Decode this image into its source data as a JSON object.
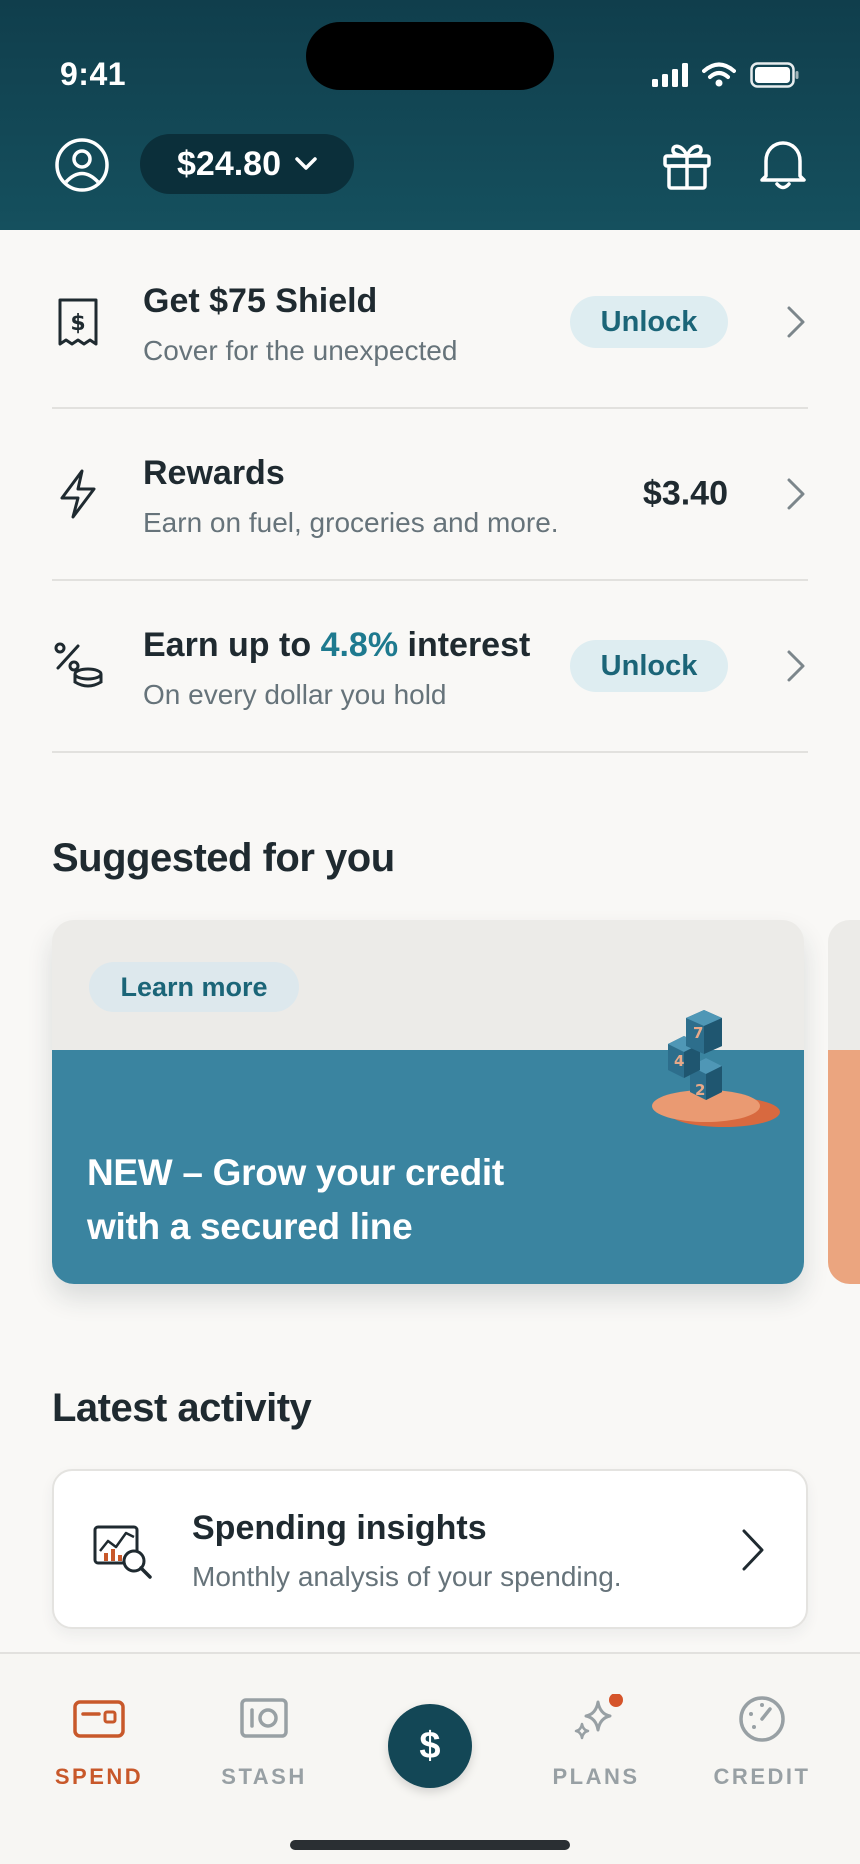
{
  "status_bar": {
    "time": "9:41"
  },
  "header": {
    "balance": "$24.80"
  },
  "rows": [
    {
      "title": "Get $75 Shield",
      "subtitle": "Cover for the unexpected",
      "action": "Unlock"
    },
    {
      "title": "Rewards",
      "subtitle": "Earn on fuel, groceries and more.",
      "value": "$3.40"
    },
    {
      "title_prefix": "Earn up to ",
      "title_accent": "4.8%",
      "title_suffix": " interest",
      "subtitle": "On every dollar you hold",
      "action": "Unlock"
    }
  ],
  "suggested": {
    "title": "Suggested for you",
    "card": {
      "badge": "Learn more",
      "headline": "NEW – Grow your credit with a secured line",
      "illustration_numbers": [
        "7",
        "4",
        "2"
      ]
    }
  },
  "activity": {
    "title": "Latest activity",
    "item": {
      "title": "Spending insights",
      "subtitle": "Monthly analysis of your spending."
    }
  },
  "tabs": [
    {
      "label": "SPEND",
      "active": true
    },
    {
      "label": "STASH",
      "active": false
    },
    {
      "label": "PLANS",
      "active": false,
      "badge_dot": true
    },
    {
      "label": "CREDIT",
      "active": false
    }
  ],
  "fab": {
    "label": "$"
  },
  "colors": {
    "header": "#134756",
    "accent": "#1e7a8f",
    "active_tab": "#c8582a",
    "card_blue": "#3a84a0",
    "card_peek": "#eba57f"
  }
}
